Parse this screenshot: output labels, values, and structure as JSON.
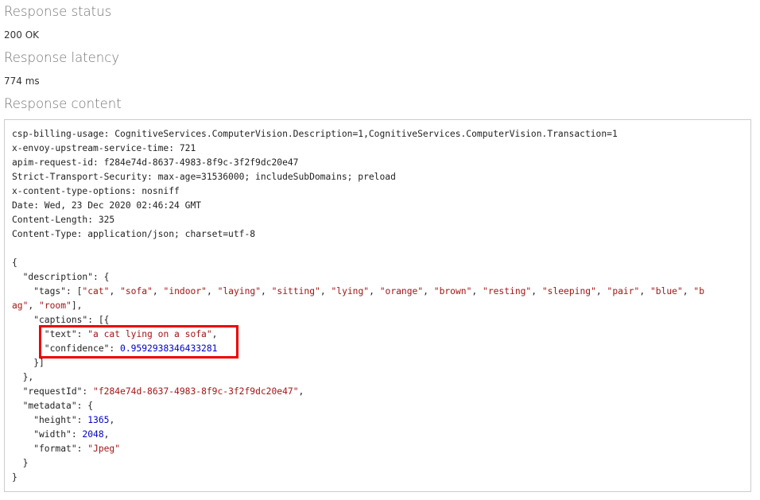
{
  "status": {
    "heading": "Response status",
    "value": "200 OK"
  },
  "latency": {
    "heading": "Response latency",
    "value": "774 ms"
  },
  "content": {
    "heading": "Response content",
    "headers": [
      "csp-billing-usage: CognitiveServices.ComputerVision.Description=1,CognitiveServices.ComputerVision.Transaction=1",
      "x-envoy-upstream-service-time: 721",
      "apim-request-id: f284e74d-8637-4983-8f9c-3f2f9dc20e47",
      "Strict-Transport-Security: max-age=31536000; includeSubDomains; preload",
      "x-content-type-options: nosniff",
      "Date: Wed, 23 Dec 2020 02:46:24 GMT",
      "Content-Length: 325",
      "Content-Type: application/json; charset=utf-8"
    ],
    "json": {
      "tags": [
        "cat",
        "sofa",
        "indoor",
        "laying",
        "sitting",
        "lying",
        "orange",
        "brown",
        "resting",
        "sleeping",
        "pair",
        "blue",
        "bag",
        "room"
      ],
      "caption_text": "a cat lying on a sofa",
      "caption_confidence": "0.9592938346433281",
      "request_id": "f284e74d-8637-4983-8f9c-3f2f9dc20e47",
      "height": "1365",
      "width": "2048",
      "format": "Jpeg"
    }
  },
  "highlight": {
    "color": "#ee0000",
    "target": "captions"
  }
}
